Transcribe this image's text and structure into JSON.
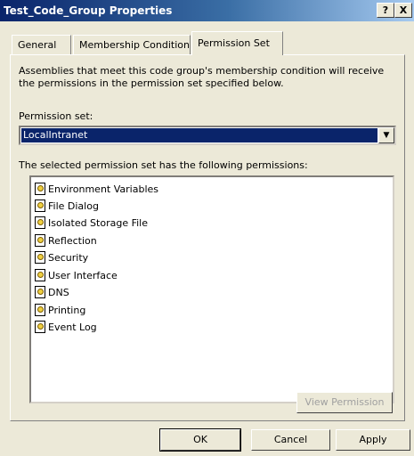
{
  "window": {
    "title": "Test_Code_Group Properties",
    "help_label": "?",
    "close_label": "X"
  },
  "tabs": [
    {
      "label": "General"
    },
    {
      "label": "Membership Condition"
    },
    {
      "label": "Permission Set"
    }
  ],
  "content": {
    "description": "Assemblies that meet this code group's membership condition will receive the permissions in the permission set specified below.",
    "permission_set_label": "Permission set:",
    "permission_set_value": "LocalIntranet",
    "permissions_label": "The selected permission set has the following permissions:",
    "permissions": [
      {
        "label": "Environment Variables",
        "icon": "permission-key-icon"
      },
      {
        "label": "File Dialog",
        "icon": "permission-key-icon"
      },
      {
        "label": "Isolated Storage File",
        "icon": "permission-key-icon"
      },
      {
        "label": "Reflection",
        "icon": "permission-key-icon"
      },
      {
        "label": "Security",
        "icon": "permission-key-icon"
      },
      {
        "label": "User Interface",
        "icon": "permission-key-icon"
      },
      {
        "label": "DNS",
        "icon": "permission-key-icon"
      },
      {
        "label": "Printing",
        "icon": "permission-key-icon"
      },
      {
        "label": "Event Log",
        "icon": "permission-key-icon"
      }
    ],
    "view_permission_label": "View Permission"
  },
  "buttons": {
    "ok": "OK",
    "cancel": "Cancel",
    "apply": "Apply"
  }
}
